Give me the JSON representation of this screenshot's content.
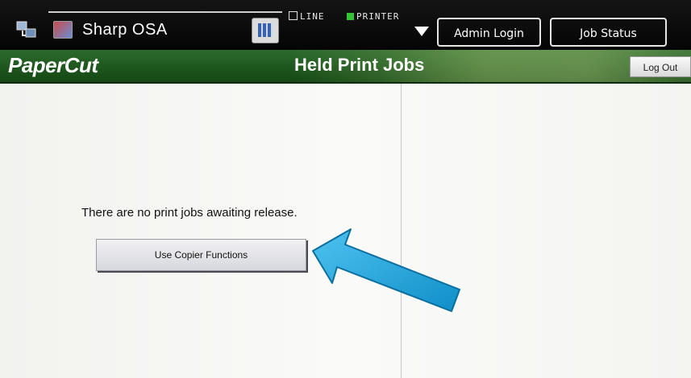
{
  "topbar": {
    "app_name": "Sharp OSA",
    "indicator_line": "LINE",
    "indicator_printer": "PRINTER",
    "admin_login": "Admin Login",
    "job_status": "Job Status",
    "icons": [
      "app-switch-icon",
      "osa-app-icon",
      "keypad-icon",
      "dropdown-arrow-icon"
    ]
  },
  "header": {
    "logo": "PaperCut",
    "title": "Held Print Jobs",
    "logout": "Log Out"
  },
  "main": {
    "message": "There are no print jobs awaiting release.",
    "copier_button": "Use Copier Functions"
  },
  "colors": {
    "header_green": "#1f5a1f",
    "topbar_black": "#0a0a0a",
    "arrow_blue": "#1aa3e0"
  }
}
